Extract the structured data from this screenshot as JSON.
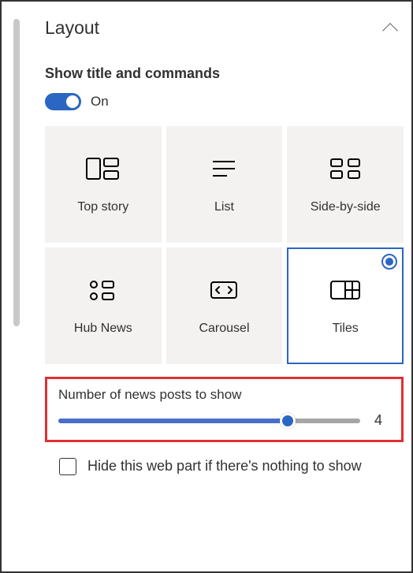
{
  "section": {
    "title": "Layout"
  },
  "toggle": {
    "heading": "Show title and commands",
    "state_label": "On",
    "on": true
  },
  "layout_options": [
    {
      "id": "top-story",
      "label": "Top story",
      "selected": false
    },
    {
      "id": "list",
      "label": "List",
      "selected": false
    },
    {
      "id": "side-by-side",
      "label": "Side-by-side",
      "selected": false
    },
    {
      "id": "hub-news",
      "label": "Hub News",
      "selected": false
    },
    {
      "id": "carousel",
      "label": "Carousel",
      "selected": false
    },
    {
      "id": "tiles",
      "label": "Tiles",
      "selected": true
    }
  ],
  "slider": {
    "label": "Number of news posts to show",
    "value": "4"
  },
  "checkbox": {
    "label": "Hide this web part if there's nothing to show",
    "checked": false
  }
}
